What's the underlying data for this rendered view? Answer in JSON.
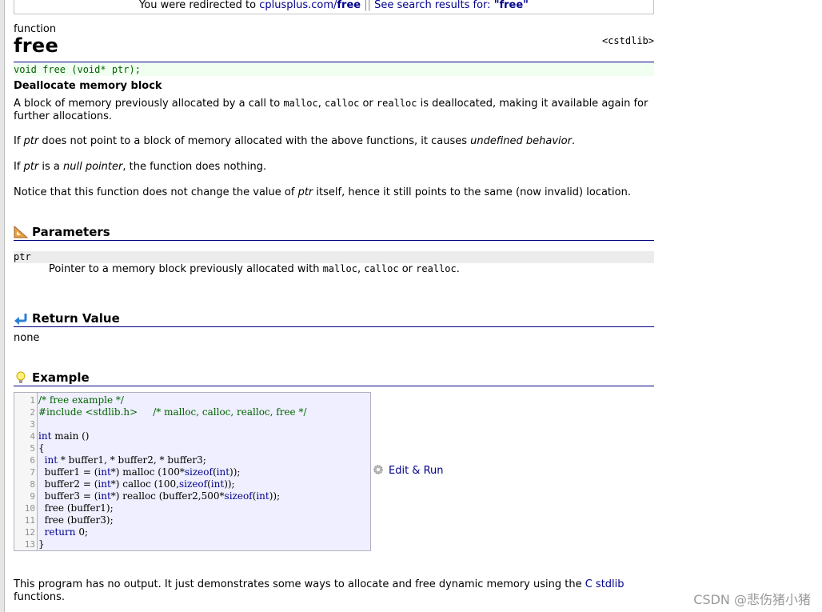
{
  "redirect": {
    "prefix": "You were redirected to ",
    "site": "cplusplus.com/",
    "page": "free",
    "separator": "||",
    "search_prefix": "See search results for: ",
    "search_term": "\"free\""
  },
  "kind": "function",
  "name": "free",
  "header": "<cstdlib>",
  "prototype": "void free (void* ptr);",
  "summary_title": "Deallocate memory block",
  "description": {
    "p1_a": "A block of memory previously allocated by a call to ",
    "p1_malloc": "malloc",
    "p1_comma": ", ",
    "p1_calloc": "calloc",
    "p1_or": " or ",
    "p1_realloc": "realloc",
    "p1_b": " is deallocated, making it available again for further allocations.",
    "p2_a": "If ",
    "p2_ptr": "ptr",
    "p2_b": " does not point to a block of memory allocated with the above functions, it causes ",
    "p2_ub": "undefined behavior",
    "p2_c": ".",
    "p3_a": "If ",
    "p3_ptr": "ptr",
    "p3_b": " is a ",
    "p3_null": "null pointer",
    "p3_c": ", the function does nothing.",
    "p4_a": "Notice that this function does not change the value of ",
    "p4_ptr": "ptr",
    "p4_b": " itself, hence it still points to the same (now invalid) location."
  },
  "sections": {
    "parameters": "Parameters",
    "return_value": "Return Value",
    "example": "Example"
  },
  "parameters": {
    "name": "ptr",
    "desc_a": "Pointer to a memory block previously allocated with ",
    "malloc": "malloc",
    "comma": ", ",
    "calloc": "calloc",
    "or": " or ",
    "realloc": "realloc",
    "end": "."
  },
  "return_value": "none",
  "example": {
    "line_numbers": [
      "1",
      "2",
      "3",
      "4",
      "5",
      "6",
      "7",
      "8",
      "9",
      "10",
      "11",
      "12",
      "13"
    ],
    "edit_run": "Edit & Run"
  },
  "footer": {
    "text": "This program has no output. It just demonstrates some ways to allocate and free dynamic memory using the ",
    "link": "C stdlib",
    "end": " functions."
  },
  "watermark": "CSDN @悲伤猪小猪",
  "colors": {
    "link": "#00008b",
    "rule": "#000080",
    "prototype_bg": "#f0fff0",
    "prototype_text": "#006400",
    "code_bg": "#efefff"
  },
  "icons": {
    "parameters": "set-square-icon",
    "return_value": "return-arrow-icon",
    "example": "lightbulb-icon",
    "edit_run": "gear-icon"
  }
}
